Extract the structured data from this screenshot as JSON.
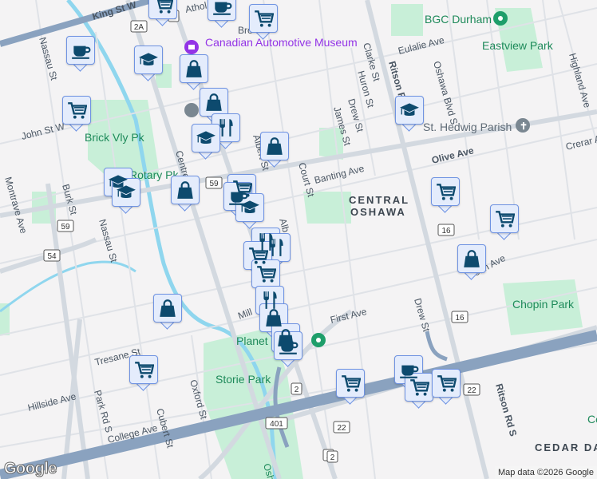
{
  "streets": [
    "King St W",
    "Athol",
    "Bro",
    "Nassau St",
    "Nassau St",
    "John St W",
    "Centre",
    "Albert St",
    "Alb",
    "Court St",
    "Banting Ave",
    "Clarke St",
    "Huron St",
    "James St",
    "Drew St",
    "Ritson Rd N",
    "Eulalie Ave",
    "Oshawa Blvd S",
    "Highland Ave",
    "Olive Ave",
    "Crerar Ave",
    "Burk St",
    "Montrave Ave",
    "Mill",
    "First Ave",
    "Drew St",
    "Tresane St",
    "Hillside Ave",
    "Park Rd S",
    "Oxford St",
    "Cubert St",
    "College Ave",
    "Ritson Rd S",
    "ean Ave",
    "Osh"
  ],
  "parks": [
    "Brick Vly Pk",
    "Rotary Pk",
    "Eastview Park",
    "Chopin Park",
    "Storie Park",
    "Co"
  ],
  "pois": {
    "museum": "Canadian Automotive Museum",
    "bgc": "BGC Durham",
    "church": "St. Hedwig Parish",
    "planet": "Planet"
  },
  "districts": [
    "CENTRAL",
    "OSHAWA",
    "CEDAR DAL"
  ],
  "shields": [
    "2A",
    "2",
    "59",
    "59",
    "54",
    "16",
    "16",
    "2",
    "401",
    "22",
    "22",
    "2",
    "2"
  ],
  "markers": [
    "cart",
    "coffee",
    "cart",
    "coffee",
    "school",
    "bag",
    "bag",
    "restaurant",
    "school",
    "bag",
    "cart",
    "school",
    "school",
    "bag",
    "cart",
    "coffee",
    "school",
    "restaurant",
    "restaurant",
    "cart",
    "cart",
    "restaurant",
    "bag",
    "bag",
    "coffee",
    "bag",
    "cart",
    "school",
    "cart",
    "cart",
    "bag",
    "coffee",
    "cart",
    "cart",
    "cart"
  ],
  "logo": "Google",
  "attribution": "Map data ©2026 Google",
  "colors": {
    "marker_icon": "#0d4a6e",
    "marker_bg": "#e4ecfc",
    "marker_border": "#6f93e2",
    "park": "#c8efd8",
    "highway": "#8aa2bf",
    "river": "#8fd6ee"
  }
}
